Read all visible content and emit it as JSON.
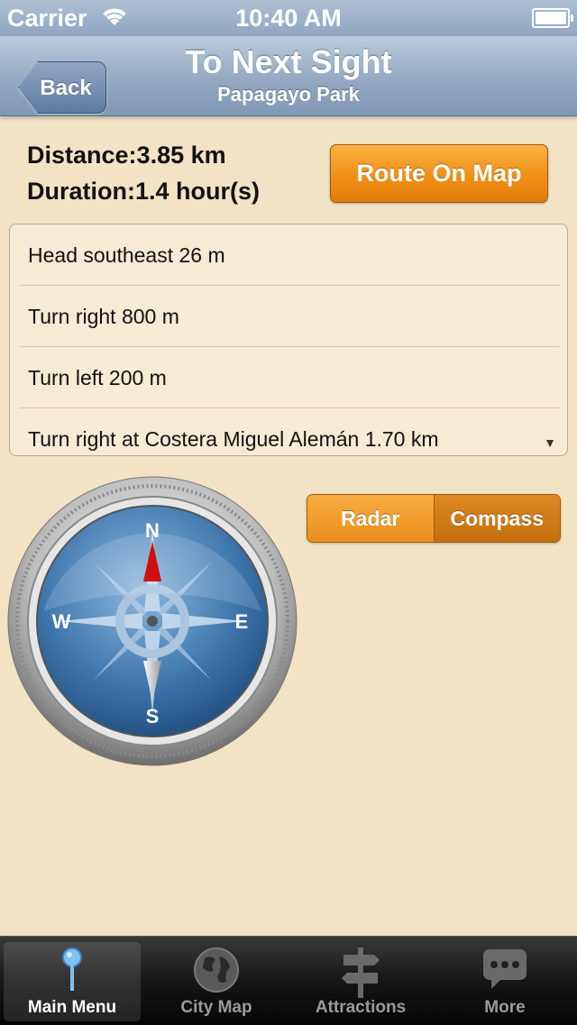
{
  "status": {
    "carrier": "Carrier",
    "time": "10:40 AM"
  },
  "nav": {
    "back_label": "Back",
    "title": "To Next Sight",
    "subtitle": "Papagayo Park"
  },
  "info": {
    "distance_label": "Distance:",
    "distance_value": "3.85 km",
    "duration_label": "Duration:",
    "duration_value": "1.4 hour(s)"
  },
  "route_button": "Route On Map",
  "steps": [
    "Head southeast 26 m",
    "Turn right 800 m",
    "Turn left 200 m",
    "Turn right at Costera Miguel Alemán 1.70 km"
  ],
  "mode": {
    "radar": "Radar",
    "compass": "Compass",
    "selected": "Compass"
  },
  "compass": {
    "n": "N",
    "s": "S",
    "e": "E",
    "w": "W"
  },
  "tabs": [
    {
      "label": "Main Menu",
      "icon": "pin-icon",
      "selected": true
    },
    {
      "label": "City Map",
      "icon": "globe-icon",
      "selected": false
    },
    {
      "label": "Attractions",
      "icon": "signpost-icon",
      "selected": false
    },
    {
      "label": "More",
      "icon": "speech-bubble-icon",
      "selected": false
    }
  ]
}
